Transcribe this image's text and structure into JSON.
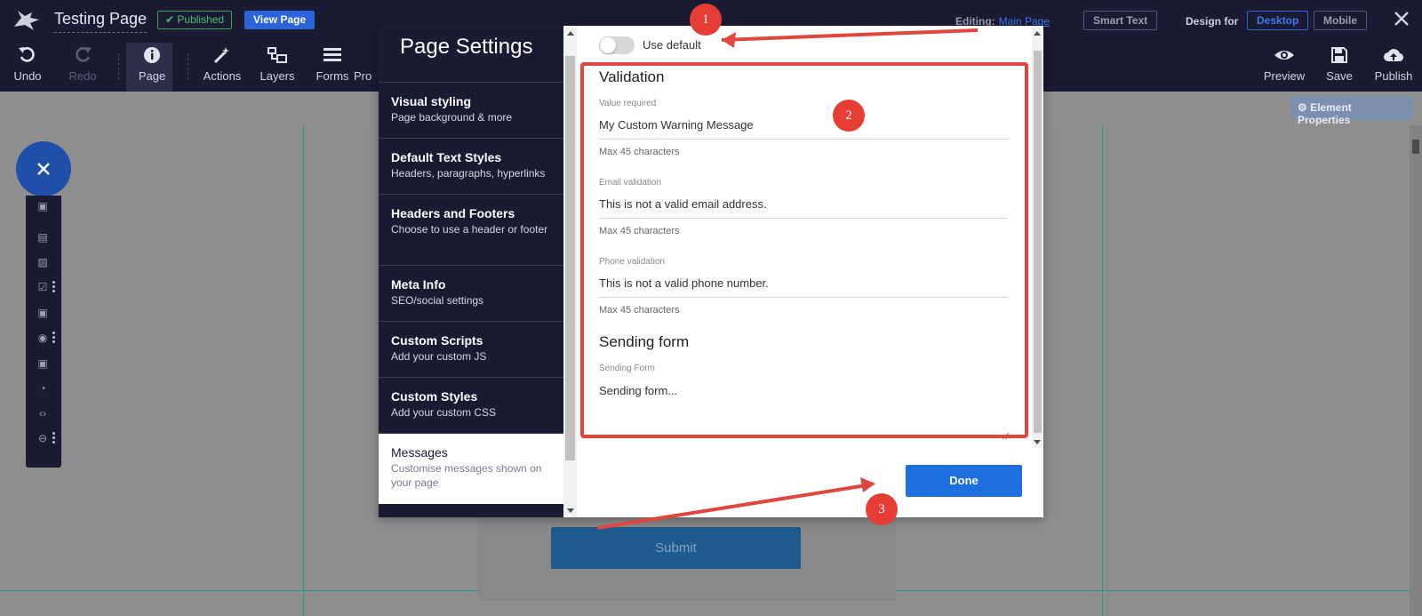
{
  "topbar": {
    "page_title": "Testing Page",
    "published_badge": "Published",
    "view_page": "View Page",
    "editing_label": "Editing:",
    "editing_page": "Main Page",
    "smart_text": "Smart Text",
    "design_for": "Design for",
    "desktop": "Desktop",
    "mobile": "Mobile"
  },
  "toolbar": {
    "undo": "Undo",
    "redo": "Redo",
    "page": "Page",
    "actions": "Actions",
    "layers": "Layers",
    "forms": "Forms",
    "forms_next_partial": "Pro",
    "preview": "Preview",
    "save": "Save",
    "publish": "Publish"
  },
  "canvas": {
    "element_properties": "⚙ Element Properties",
    "submit": "Submit"
  },
  "modal": {
    "title": "Page Settings",
    "nav": [
      {
        "title": "Visual styling",
        "subtitle": "Page background & more"
      },
      {
        "title": "Default Text Styles",
        "subtitle": "Headers, paragraphs, hyperlinks"
      },
      {
        "title": "Headers and Footers",
        "subtitle": "Choose to use a header or footer"
      },
      {
        "title": "Meta Info",
        "subtitle": "SEO/social settings"
      },
      {
        "title": "Custom Scripts",
        "subtitle": "Add your custom JS"
      },
      {
        "title": "Custom Styles",
        "subtitle": "Add your custom CSS"
      },
      {
        "title": "Messages",
        "subtitle": "Customise messages shown on your page"
      }
    ],
    "use_default": "Use default",
    "use_default_on": false,
    "validation_heading": "Validation",
    "fields": [
      {
        "label": "Value required",
        "value": "My Custom Warning Message",
        "hint": "Max 45 characters"
      },
      {
        "label": "Email validation",
        "value": "This is not a valid email address.",
        "hint": "Max 45 characters"
      },
      {
        "label": "Phone validation",
        "value": "This is not a valid phone number.",
        "hint": "Max 45 characters"
      }
    ],
    "sending_heading": "Sending form",
    "sending_label": "Sending Form",
    "sending_value": "Sending form...",
    "done": "Done"
  },
  "annotations": {
    "markers": [
      "1",
      "2",
      "3"
    ],
    "color": "#e53c34"
  },
  "colors": {
    "topbar_bg": "#1b1a33",
    "accent_blue": "#1e6fe0",
    "published_green": "#3aa35a"
  }
}
